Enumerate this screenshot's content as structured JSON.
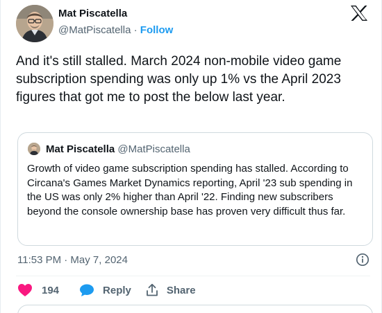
{
  "author": {
    "name": "Mat Piscatella",
    "handle": "@MatPiscatella",
    "separator": "·",
    "follow_label": "Follow"
  },
  "tweet": {
    "text": "And it's still stalled. March 2024 non-mobile video game subscription spending was only up 1% vs the April 2023 figures that got me to post the below last year.",
    "timestamp": "11:53 PM · May 7, 2024"
  },
  "quoted_tweet": {
    "author_name": "Mat Piscatella",
    "author_handle": "@MatPiscatella",
    "text": "Growth of video game subscription spending has stalled. According to Circana's Games Market Dynamics reporting, April '23 sub spending in the US was only 2% higher than April '22. Finding new subscribers beyond the console ownership base has proven very difficult thus far."
  },
  "actions": {
    "like_count": "194",
    "reply_label": "Reply",
    "share_label": "Share"
  },
  "icons": {
    "platform_logo": "x-logo-icon",
    "info": "info-icon",
    "like": "heart-icon",
    "reply": "speech-bubble-icon",
    "share": "share-upload-icon"
  },
  "colors": {
    "accent": "#1d9bf0",
    "like": "#f91880",
    "text_primary": "#0f1419",
    "text_secondary": "#536471",
    "border": "#cfd9de"
  }
}
